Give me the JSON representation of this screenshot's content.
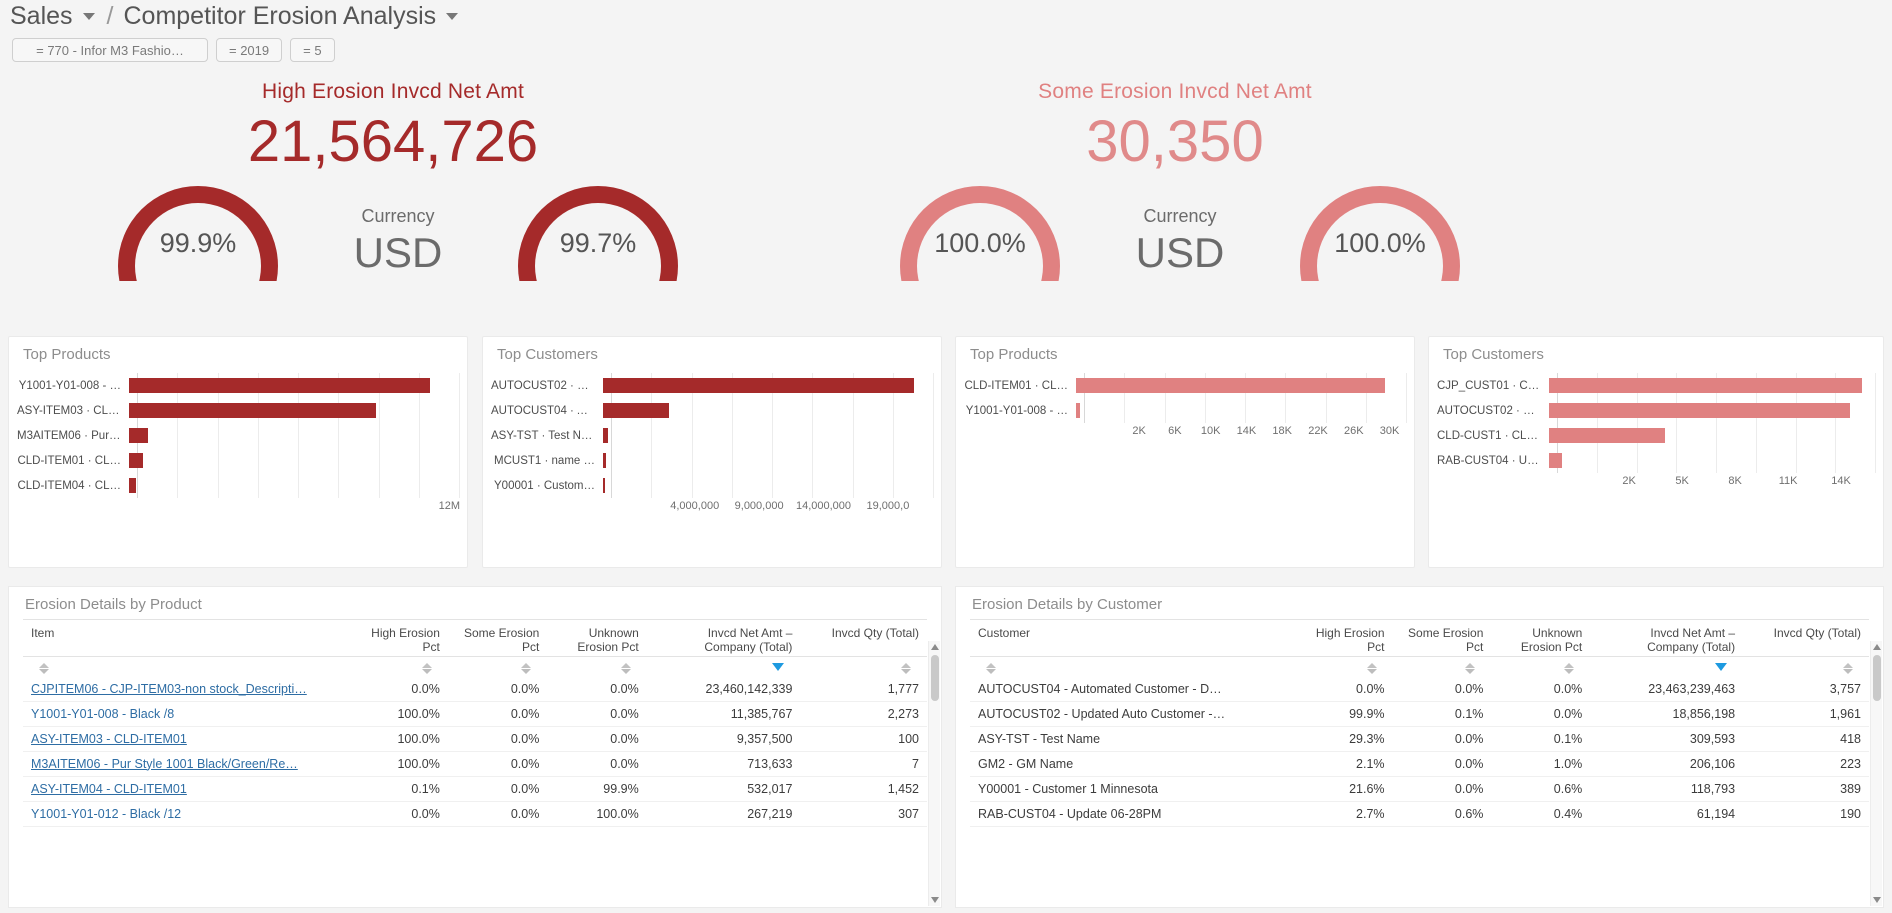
{
  "breadcrumb": {
    "root": "Sales",
    "separator": "/",
    "current": "Competitor Erosion Analysis"
  },
  "filters": [
    {
      "label": "= 770 - Infor M3 Fashio…"
    },
    {
      "label": "= 2019"
    },
    {
      "label": "= 5"
    }
  ],
  "colors": {
    "dark_red": "#a52a2a",
    "light_red": "#e08181",
    "link": "#2e6da4",
    "sort_active": "#1e9ae0"
  },
  "kpis": [
    {
      "title": "High Erosion Invcd Net Amt",
      "value": "21,564,726",
      "tone": "dark",
      "gauge_left": {
        "pct_label": "99.9%",
        "pct": 99.9
      },
      "gauge_right": {
        "pct_label": "99.7%",
        "pct": 99.7
      },
      "currency_label": "Currency",
      "currency_value": "USD"
    },
    {
      "title": "Some Erosion Invcd Net Amt",
      "value": "30,350",
      "tone": "lite",
      "gauge_left": {
        "pct_label": "100.0%",
        "pct": 100.0
      },
      "gauge_right": {
        "pct_label": "100.0%",
        "pct": 100.0
      },
      "currency_label": "Currency",
      "currency_value": "USD"
    }
  ],
  "chart_data": [
    {
      "id": "high-top-products",
      "type": "bar",
      "title": "Top Products",
      "orientation": "horizontal",
      "tone": "dark",
      "categories": [
        "Y1001-Y01-008 - …",
        "ASY-ITEM03 · CLD…",
        "M3AITEM06 · Pur …",
        "CLD-ITEM01 · CL…",
        "CLD-ITEM04 · CL…"
      ],
      "values": [
        11385767,
        9357500,
        713633,
        532017,
        267219
      ],
      "tick_labels": [
        "12M"
      ],
      "xlabel": "",
      "ylabel": "",
      "xlim": [
        0,
        12500000
      ],
      "grid": true,
      "legend": false
    },
    {
      "id": "high-top-customers",
      "type": "bar",
      "title": "Top Customers",
      "orientation": "horizontal",
      "tone": "dark",
      "categories": [
        "AUTOCUST02 · U…",
        "AUTOCUST04 · A…",
        "ASY-TST · Test Na…",
        "MCUST1 · name …",
        "Y00001 · Custom…"
      ],
      "values": [
        18856198,
        4000000,
        309593,
        206106,
        118793
      ],
      "tick_labels": [
        "4,000,000",
        "9,000,000",
        "14,000,000",
        "19,000,0"
      ],
      "xlabel": "",
      "ylabel": "",
      "xlim": [
        0,
        20000000
      ],
      "grid": true,
      "legend": false
    },
    {
      "id": "some-top-products",
      "type": "bar",
      "title": "Top Products",
      "orientation": "horizontal",
      "tone": "lite",
      "categories": [
        "CLD-ITEM01 · CL…",
        "Y1001-Y01-008 - …"
      ],
      "values": [
        30000,
        400
      ],
      "tick_labels": [
        "2K",
        "6K",
        "10K",
        "14K",
        "18K",
        "22K",
        "26K",
        "30K"
      ],
      "xlabel": "",
      "ylabel": "",
      "xlim": [
        0,
        32000
      ],
      "grid": true,
      "legend": false
    },
    {
      "id": "some-top-customers",
      "type": "bar",
      "title": "Top Customers",
      "orientation": "horizontal",
      "tone": "lite",
      "categories": [
        "CJP_CUST01 · CJP…",
        "AUTOCUST02 · U…",
        "CLD-CUST1 · CLD-…",
        "RAB-CUST04 · Up…"
      ],
      "values": [
        14000,
        13500,
        5200,
        600
      ],
      "tick_labels": [
        "2K",
        "5K",
        "8K",
        "11K",
        "14K"
      ],
      "xlabel": "",
      "ylabel": "",
      "xlim": [
        0,
        14600
      ],
      "grid": true,
      "legend": false
    }
  ],
  "table_product": {
    "title": "Erosion Details by Product",
    "columns": [
      {
        "label": "Item",
        "align": "left",
        "sorted": false
      },
      {
        "label": "High Erosion Pct",
        "align": "right",
        "sorted": false
      },
      {
        "label": "Some Erosion Pct",
        "align": "right",
        "sorted": false
      },
      {
        "label": "Unknown Erosion Pct",
        "align": "right",
        "sorted": false
      },
      {
        "label": "Invcd Net Amt – Company (Total)",
        "align": "right",
        "sorted": true
      },
      {
        "label": "Invcd Qty (Total)",
        "align": "right",
        "sorted": false
      }
    ],
    "rows": [
      {
        "item": "CJPITEM06 - CJP-ITEM03-non stock_Descripti…",
        "high": "0.0%",
        "some": "0.0%",
        "unknown": "0.0%",
        "amount": "23,460,142,339",
        "qty": "1,777"
      },
      {
        "item": "Y1001-Y01-008 - Black /8",
        "high": "100.0%",
        "some": "0.0%",
        "unknown": "0.0%",
        "amount": "11,385,767",
        "qty": "2,273"
      },
      {
        "item": "ASY-ITEM03 - CLD-ITEM01",
        "high": "100.0%",
        "some": "0.0%",
        "unknown": "0.0%",
        "amount": "9,357,500",
        "qty": "100"
      },
      {
        "item": "M3AITEM06 - Pur Style 1001 Black/Green/Re…",
        "high": "100.0%",
        "some": "0.0%",
        "unknown": "0.0%",
        "amount": "713,633",
        "qty": "7"
      },
      {
        "item": "ASY-ITEM04 - CLD-ITEM01",
        "high": "0.1%",
        "some": "0.0%",
        "unknown": "99.9%",
        "amount": "532,017",
        "qty": "1,452"
      },
      {
        "item": "Y1001-Y01-012 - Black /12",
        "high": "0.0%",
        "some": "0.0%",
        "unknown": "100.0%",
        "amount": "267,219",
        "qty": "307"
      }
    ]
  },
  "table_customer": {
    "title": "Erosion Details by Customer",
    "columns": [
      {
        "label": "Customer",
        "align": "left",
        "sorted": false
      },
      {
        "label": "High Erosion Pct",
        "align": "right",
        "sorted": false
      },
      {
        "label": "Some Erosion Pct",
        "align": "right",
        "sorted": false
      },
      {
        "label": "Unknown Erosion Pct",
        "align": "right",
        "sorted": false
      },
      {
        "label": "Invcd Net Amt – Company (Total)",
        "align": "right",
        "sorted": true
      },
      {
        "label": "Invcd Qty (Total)",
        "align": "right",
        "sorted": false
      }
    ],
    "rows": [
      {
        "item": "AUTOCUST04 - Automated Customer - D…",
        "high": "0.0%",
        "some": "0.0%",
        "unknown": "0.0%",
        "amount": "23,463,239,463",
        "qty": "3,757"
      },
      {
        "item": "AUTOCUST02 - Updated Auto Customer -…",
        "high": "99.9%",
        "some": "0.1%",
        "unknown": "0.0%",
        "amount": "18,856,198",
        "qty": "1,961"
      },
      {
        "item": "ASY-TST - Test Name",
        "high": "29.3%",
        "some": "0.0%",
        "unknown": "0.1%",
        "amount": "309,593",
        "qty": "418"
      },
      {
        "item": "GM2 - GM Name",
        "high": "2.1%",
        "some": "0.0%",
        "unknown": "1.0%",
        "amount": "206,106",
        "qty": "223"
      },
      {
        "item": "Y00001 - Customer 1 Minnesota",
        "high": "21.6%",
        "some": "0.0%",
        "unknown": "0.6%",
        "amount": "118,793",
        "qty": "389"
      },
      {
        "item": "RAB-CUST04 - Update 06-28PM",
        "high": "2.7%",
        "some": "0.6%",
        "unknown": "0.4%",
        "amount": "61,194",
        "qty": "190"
      }
    ]
  }
}
